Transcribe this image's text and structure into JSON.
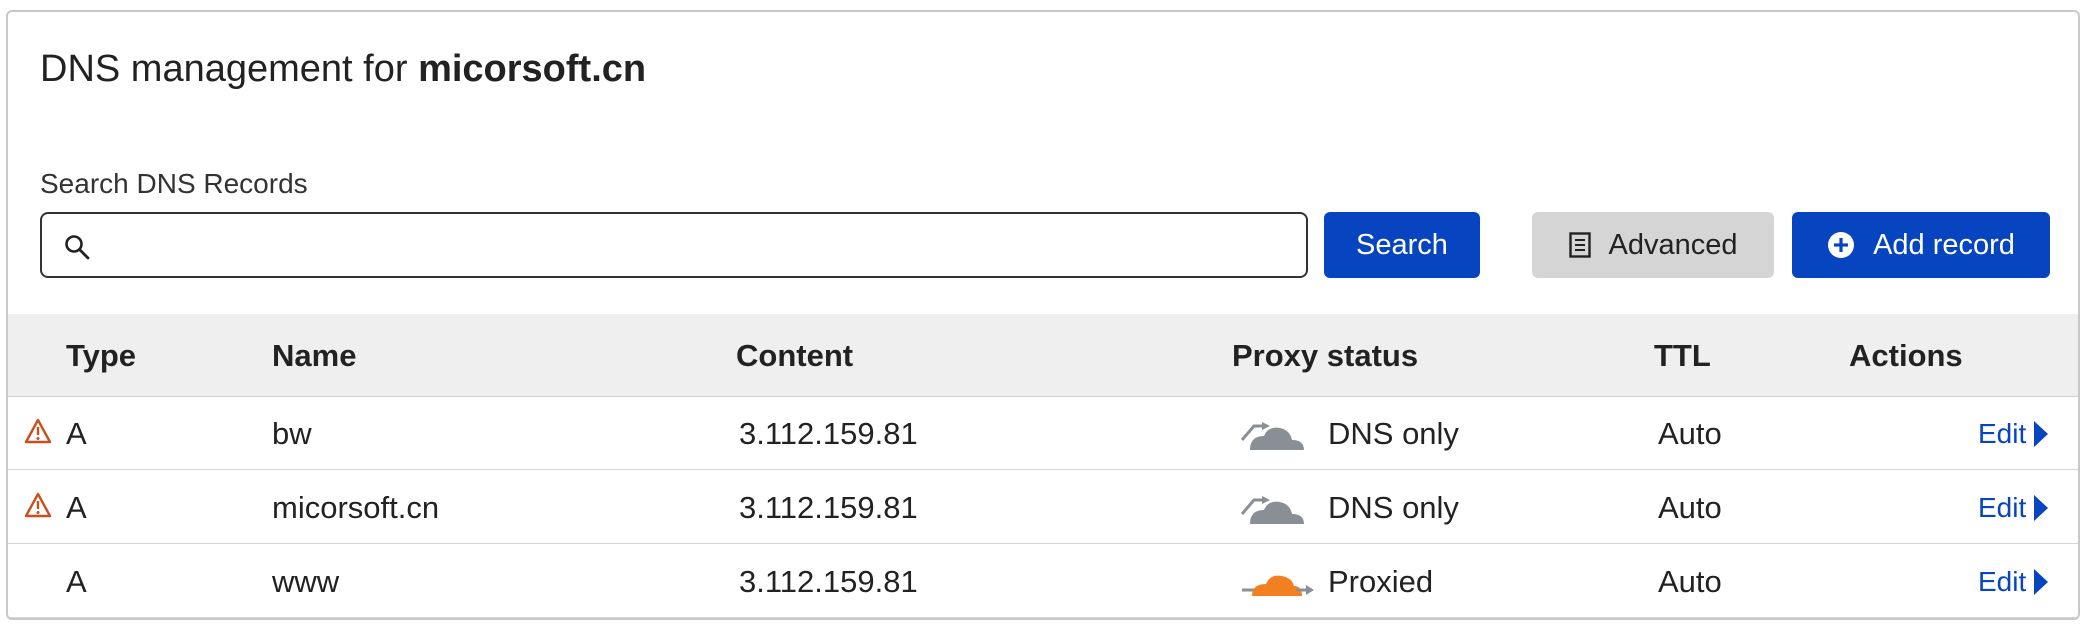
{
  "header": {
    "title_prefix": "DNS management for ",
    "domain": "micorsoft.cn"
  },
  "search": {
    "label": "Search DNS Records",
    "value": "",
    "placeholder": "",
    "button_label": "Search"
  },
  "toolbar": {
    "advanced_label": "Advanced",
    "add_record_label": "Add record"
  },
  "table": {
    "columns": [
      "Type",
      "Name",
      "Content",
      "Proxy status",
      "TTL",
      "Actions"
    ],
    "rows": [
      {
        "warning": true,
        "type": "A",
        "name": "bw",
        "content": "3.112.159.81",
        "proxy_status": "DNS only",
        "proxy_icon": "cloud-dns-only-icon",
        "ttl": "Auto",
        "action": "Edit"
      },
      {
        "warning": true,
        "type": "A",
        "name": "micorsoft.cn",
        "content": "3.112.159.81",
        "proxy_status": "DNS only",
        "proxy_icon": "cloud-dns-only-icon",
        "ttl": "Auto",
        "action": "Edit"
      },
      {
        "warning": false,
        "type": "A",
        "name": "www",
        "content": "3.112.159.81",
        "proxy_status": "Proxied",
        "proxy_icon": "cloud-proxied-icon",
        "ttl": "Auto",
        "action": "Edit"
      }
    ]
  },
  "colors": {
    "primary": "#0745c0",
    "warning": "#c8501e",
    "proxied": "#f38020",
    "dns_only": "#8a8f95"
  }
}
